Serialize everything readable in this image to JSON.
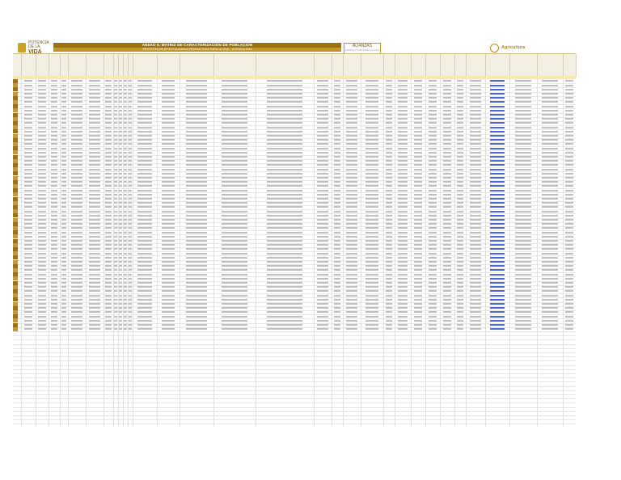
{
  "header": {
    "left_logo_line1": "POTENCIA",
    "left_logo_line2": "DE LA",
    "left_logo_word": "VIDA",
    "title": "ANEXO 8. MATRIZ DE CARACTERIZACIÓN DE POBLACIÓN",
    "subtitle": "PROYECTO DE APOYO ALIANZAS PRODUCTIVAS PARA LA VIDA - VIGENCIA 2023",
    "mid_brand": "ALIANZAS",
    "mid_brand_sub": "PRODUCTIVAS PARA LA VIDA",
    "right_brand": "Agricultura"
  },
  "grid": {
    "filled_rows": 60,
    "empty_rows": 22,
    "link_text": "correo@correo.com"
  }
}
